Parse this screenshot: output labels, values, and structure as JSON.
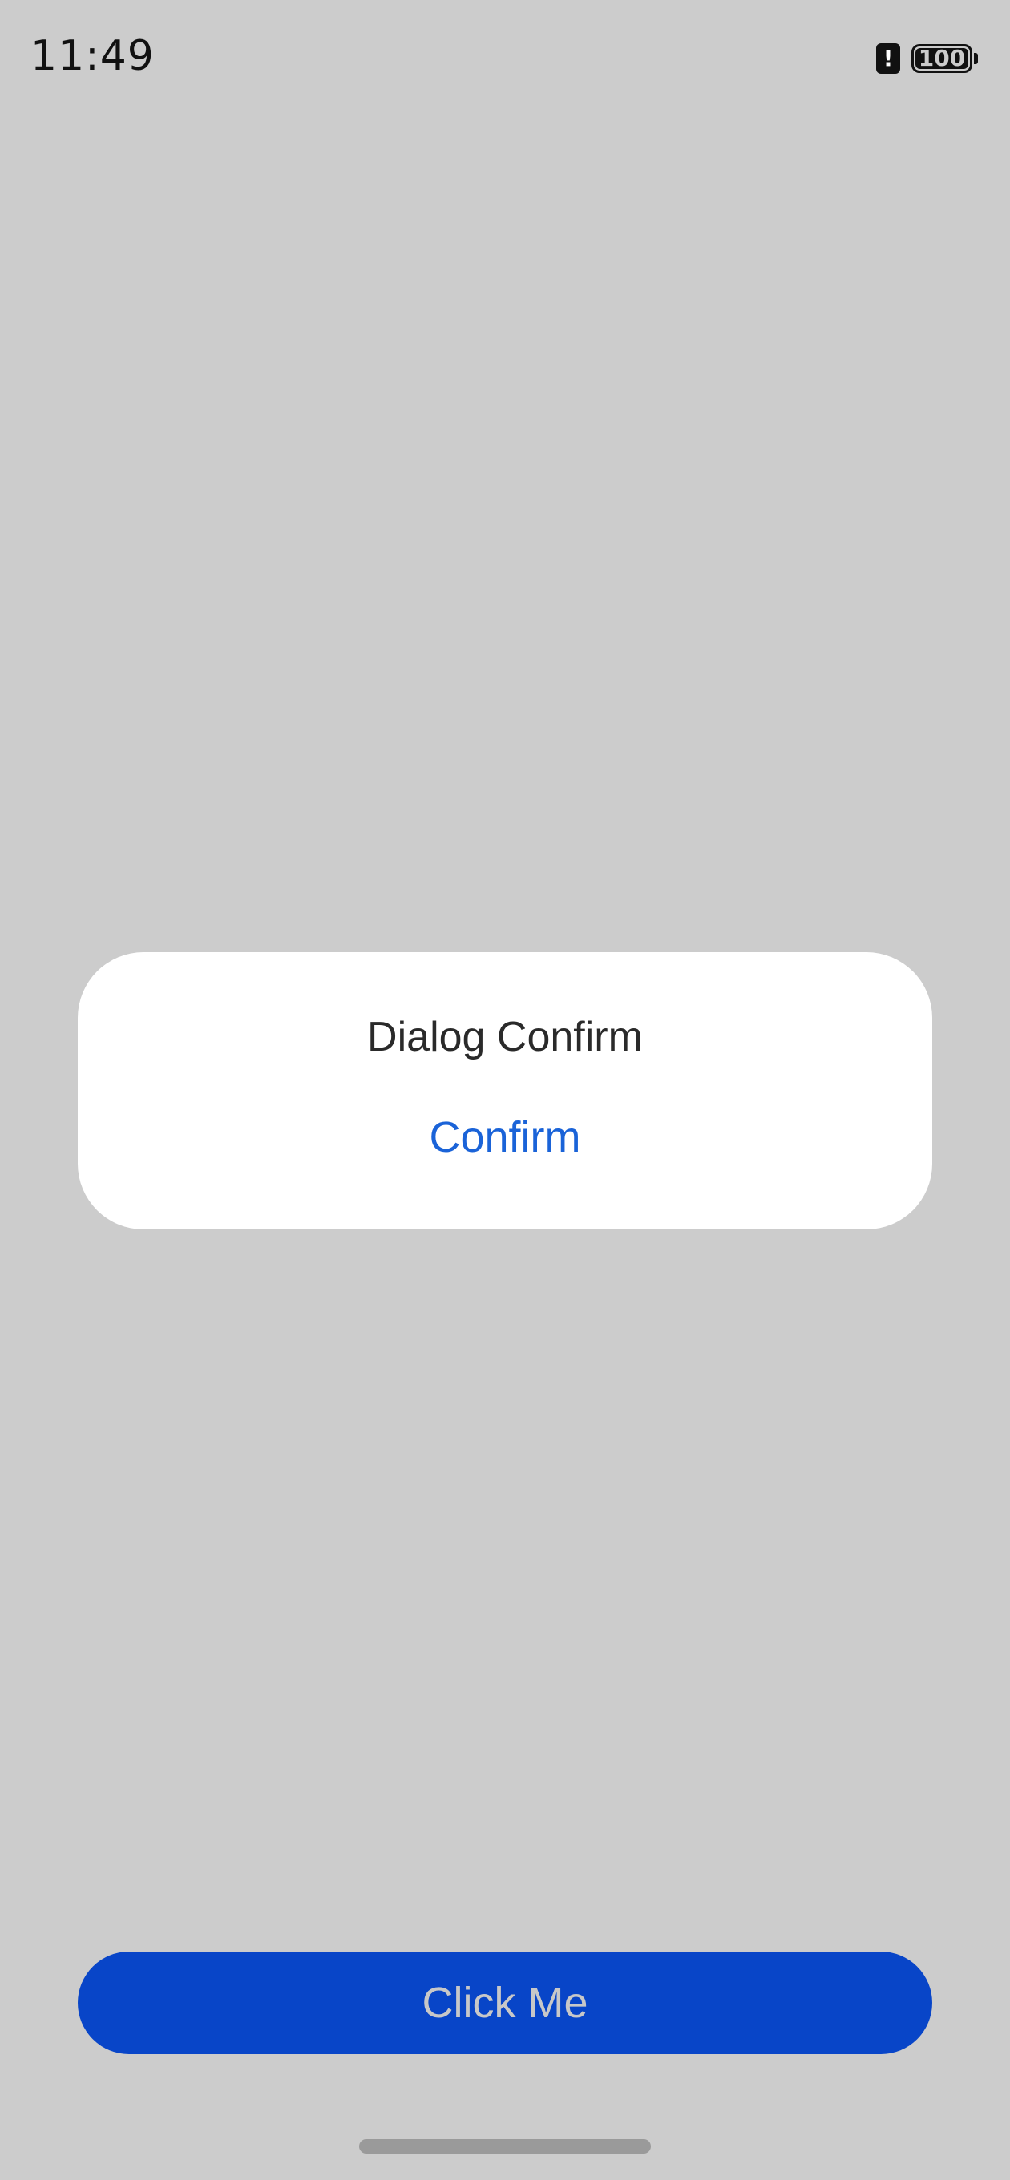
{
  "status_bar": {
    "time": "11:49",
    "alert_icon": "!",
    "battery_level": "100"
  },
  "dialog": {
    "title": "Dialog Confirm",
    "confirm_label": "Confirm"
  },
  "main_button": {
    "label": "Click Me"
  },
  "colors": {
    "background": "#cccccc",
    "dialog_background": "#ffffff",
    "confirm_text": "#1a63d8",
    "button_background": "#0845c8",
    "button_text": "#c8c8c8"
  }
}
